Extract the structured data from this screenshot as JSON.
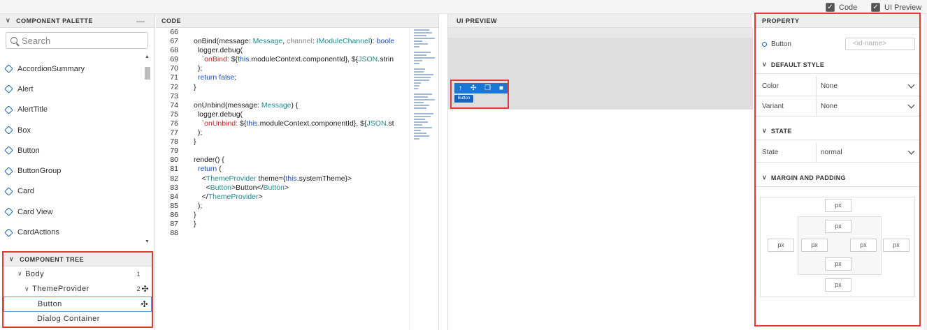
{
  "topbar": {
    "code_label": "Code",
    "preview_label": "UI Preview",
    "check_glyph": "✓"
  },
  "palette": {
    "title": "COMPONENT PALETTE",
    "search_placeholder": "Search",
    "items": [
      "AccordionSummary",
      "Alert",
      "AlertTitle",
      "Box",
      "Button",
      "ButtonGroup",
      "Card",
      "Card View",
      "CardActions"
    ]
  },
  "tree": {
    "title": "COMPONENT TREE",
    "items": [
      {
        "label": "Body",
        "count": "1",
        "move": ""
      },
      {
        "label": "ThemeProvider",
        "count": "2",
        "move": "✣"
      },
      {
        "label": "Button",
        "count": "",
        "move": "✣"
      },
      {
        "label": "Dialog Container",
        "count": "",
        "move": ""
      }
    ]
  },
  "code": {
    "title": "CODE",
    "line_numbers": [
      "66",
      "67",
      "68",
      "69",
      "70",
      "71",
      "72",
      "73",
      "74",
      "75",
      "76",
      "77",
      "78",
      "79",
      "80",
      "81",
      "82",
      "83",
      "84",
      "85",
      "86",
      "87",
      "88"
    ]
  },
  "preview": {
    "title": "UI PREVIEW",
    "button_label": "Button"
  },
  "property": {
    "title": "PROPERTY",
    "component_name": "Button",
    "id_placeholder": "<id-name>",
    "sections": {
      "default_style": "DEFAULT STYLE",
      "state": "STATE",
      "margin_padding": "MARGIN AND PADDING"
    },
    "color_label": "Color",
    "color_value": "None",
    "variant_label": "Variant",
    "variant_value": "None",
    "state_label": "State",
    "state_value": "normal",
    "px_label": "px"
  }
}
